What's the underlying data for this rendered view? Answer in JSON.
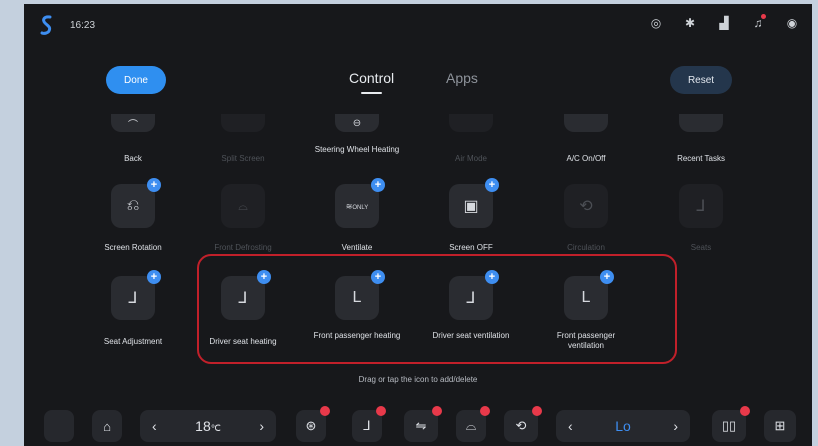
{
  "status": {
    "time": "16:23"
  },
  "header": {
    "done_label": "Done",
    "reset_label": "Reset",
    "tabs": [
      {
        "label": "Control"
      },
      {
        "label": "Apps"
      }
    ]
  },
  "rows": [
    {
      "labels": [
        "Back",
        "Split Screen",
        "Steering Wheel Heating",
        "Air Mode",
        "A/C On/Off",
        "Recent Tasks"
      ]
    },
    {
      "labels": [
        "Screen Rotation",
        "Front Defrosting",
        "Ventilate",
        "Screen OFF",
        "Circulation",
        "Seats"
      ]
    },
    {
      "labels": [
        "Seat Adjustment",
        "Driver seat heating",
        "Front passenger heating",
        "Driver seat ventilation",
        "Front passenger ventilation"
      ]
    }
  ],
  "ventilate_icon_text": "ONLY",
  "hint": "Drag or tap the icon to add/delete",
  "dock": {
    "left_temp": {
      "value": "18",
      "unit": "℃"
    },
    "right_temp": {
      "value": "Lo"
    }
  },
  "colors": {
    "accent": "#3e8ef1",
    "highlight": "#c1202a",
    "badge": "#e8394a"
  }
}
